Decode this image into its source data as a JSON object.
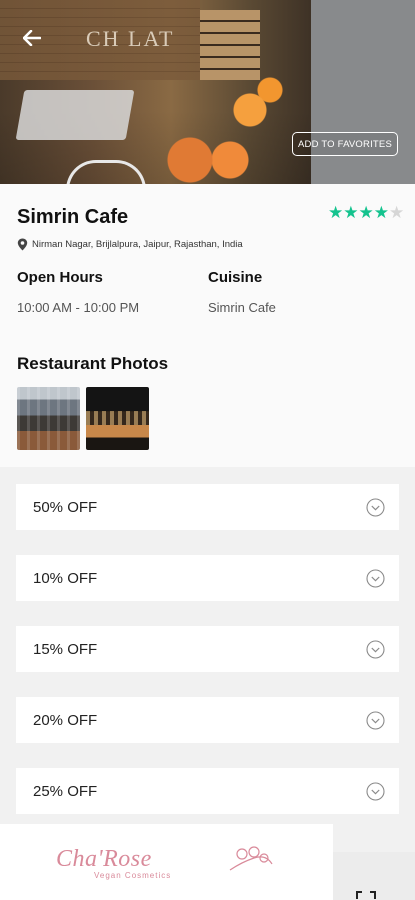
{
  "hero": {
    "sign_text": "CH LAT",
    "favorites_label": "ADD TO FAVORITES"
  },
  "restaurant": {
    "name": "Simrin Cafe",
    "rating": 4,
    "rating_max": 5,
    "address": "Nirman Nagar, Brijlalpura, Jaipur, Rajasthan, India",
    "open_hours_label": "Open Hours",
    "open_hours_value": "10:00 AM - 10:00 PM",
    "cuisine_label": "Cuisine",
    "cuisine_value": "Simrin Cafe"
  },
  "photos": {
    "title": "Restaurant Photos"
  },
  "offers": [
    {
      "label": "50% OFF"
    },
    {
      "label": "10% OFF"
    },
    {
      "label": "15% OFF"
    },
    {
      "label": "20% OFF"
    },
    {
      "label": "25% OFF"
    }
  ],
  "ad": {
    "brand": "Cha'Rose",
    "tagline": "Vegan Cosmetics"
  },
  "colors": {
    "star": "#14c38e",
    "star_empty": "#d6d6d6",
    "ad_pink": "#d98a9a"
  },
  "icons": [
    "back-arrow-icon",
    "location-pin-icon",
    "star-icon",
    "chevron-down-icon",
    "flower-icon",
    "expand-icon"
  ]
}
